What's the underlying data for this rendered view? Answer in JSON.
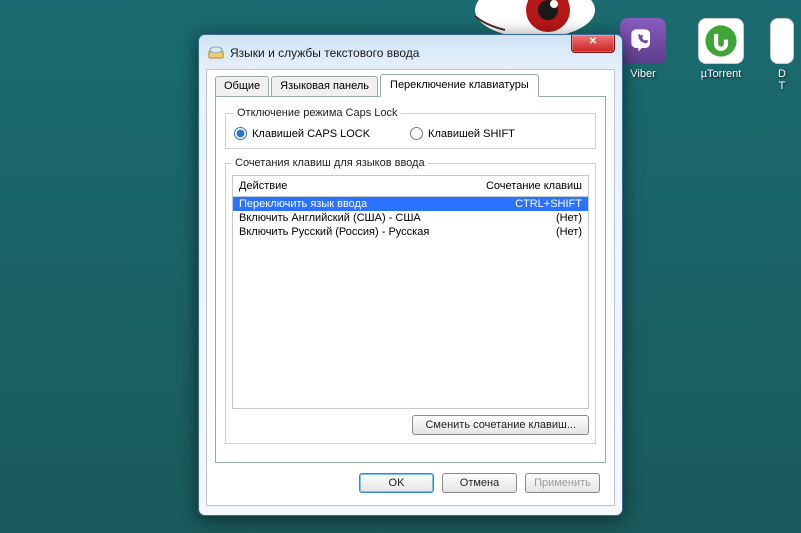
{
  "desktop": {
    "icons": [
      {
        "label": "Viber"
      },
      {
        "label": "µTorrent"
      },
      {
        "label": "D"
      },
      {
        "label2": "T"
      }
    ]
  },
  "window": {
    "title": "Языки и службы текстового ввода",
    "close": "✕"
  },
  "tabs": {
    "general": "Общие",
    "langbar": "Языковая панель",
    "switch": "Переключение клавиатуры"
  },
  "caps": {
    "legend": "Отключение режима Caps Lock",
    "capslock": "Клавишей CAPS LOCK",
    "shift": "Клавишей SHIFT"
  },
  "hotkeys": {
    "legend": "Сочетания клавиш для языков ввода",
    "col_action": "Действие",
    "col_combo": "Сочетание клавиш",
    "rows": [
      {
        "action": "Переключить язык ввода",
        "combo": "CTRL+SHIFT"
      },
      {
        "action": "Включить Английский (США) - США",
        "combo": "(Нет)"
      },
      {
        "action": "Включить Русский (Россия) - Русская",
        "combo": "(Нет)"
      }
    ],
    "change_btn": "Сменить сочетание клавиш..."
  },
  "buttons": {
    "ok": "OK",
    "cancel": "Отмена",
    "apply": "Применить"
  }
}
